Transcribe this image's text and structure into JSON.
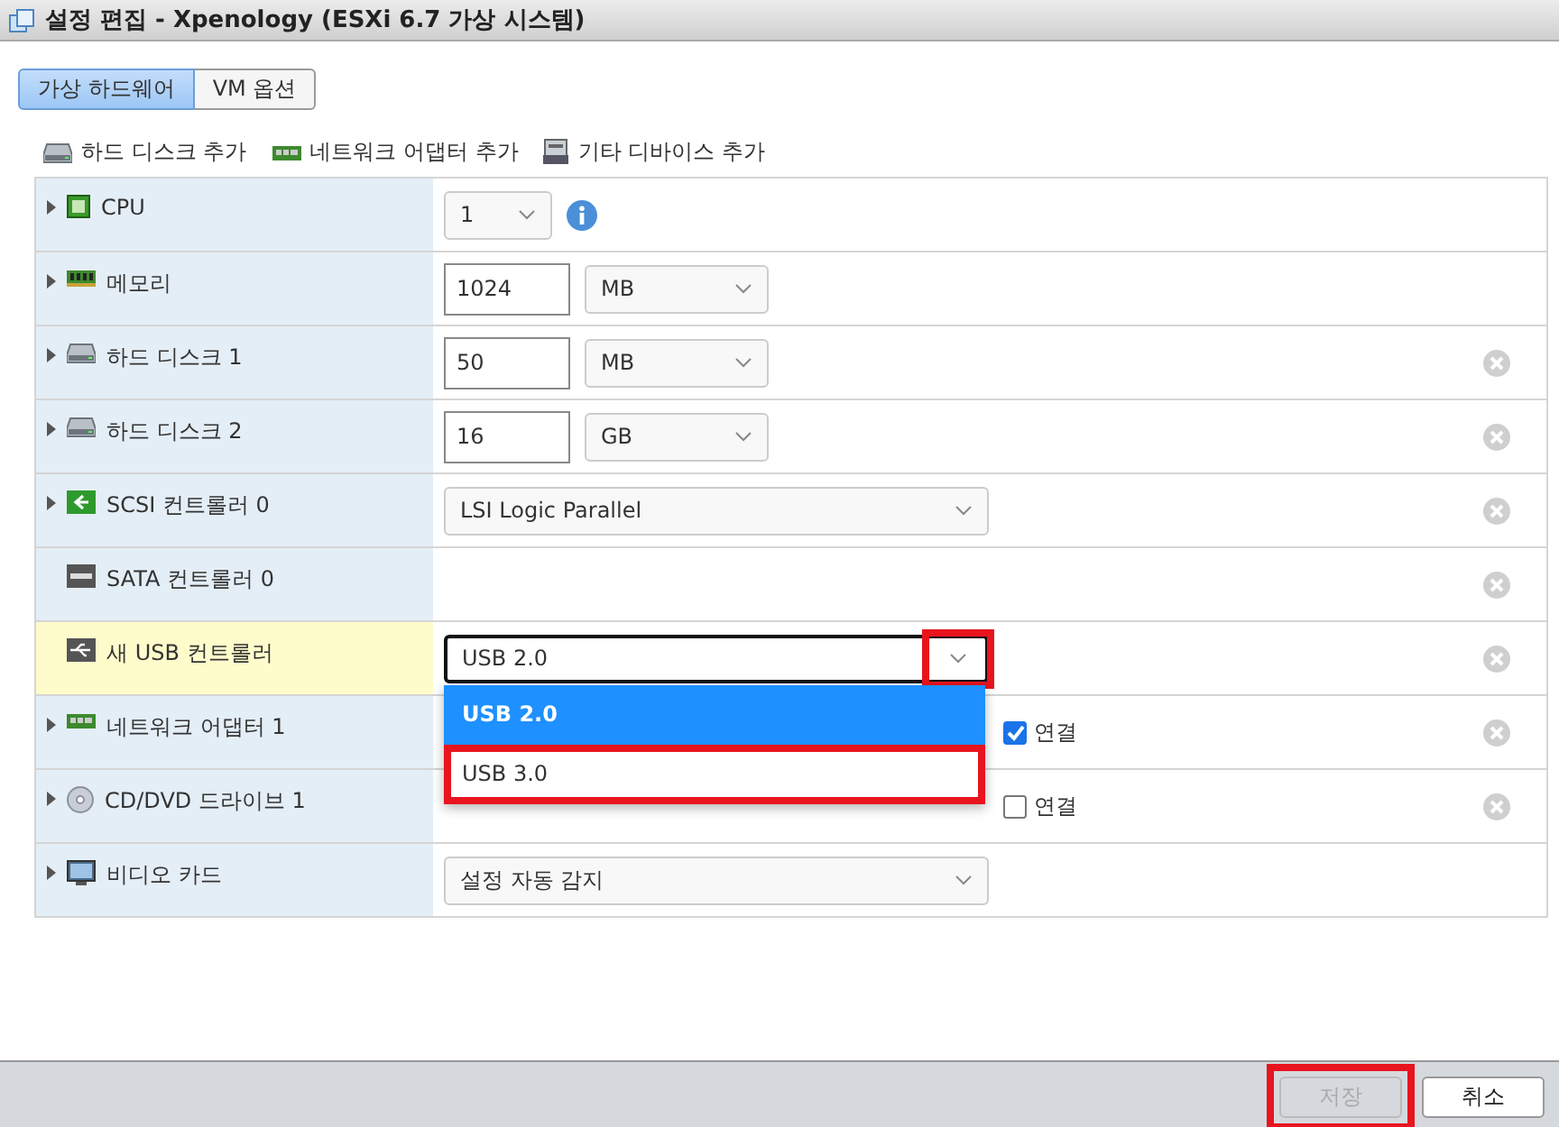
{
  "window": {
    "title": "설정 편집 - Xpenology (ESXi 6.7 가상 시스템)"
  },
  "tabs": [
    {
      "label": "가상 하드웨어",
      "selected": true
    },
    {
      "label": "VM 옵션",
      "selected": false
    }
  ],
  "toolbar": [
    {
      "kind": "disk",
      "label": "하드 디스크 추가"
    },
    {
      "kind": "network",
      "label": "네트워크 어댑터 추가"
    },
    {
      "kind": "other",
      "label": "기타 디바이스 추가"
    }
  ],
  "devices": [
    {
      "kind": "cpu",
      "label": "CPU",
      "expandable": true,
      "removable": false,
      "new": false,
      "control": {
        "kind": "small_select",
        "value": "1",
        "info": true
      }
    },
    {
      "kind": "memory",
      "label": "메모리",
      "expandable": true,
      "removable": false,
      "new": false,
      "control": {
        "kind": "size",
        "value": "1024",
        "unit": "MB"
      }
    },
    {
      "kind": "disk",
      "label": "하드 디스크 1",
      "expandable": true,
      "removable": true,
      "new": false,
      "control": {
        "kind": "size",
        "value": "50",
        "unit": "MB"
      }
    },
    {
      "kind": "disk",
      "label": "하드 디스크 2",
      "expandable": true,
      "removable": true,
      "new": false,
      "control": {
        "kind": "size",
        "value": "16",
        "unit": "GB"
      }
    },
    {
      "kind": "scsi",
      "label": "SCSI 컨트롤러 0",
      "expandable": true,
      "removable": true,
      "new": false,
      "control": {
        "kind": "select",
        "value": "LSI Logic Parallel"
      }
    },
    {
      "kind": "sata",
      "label": "SATA 컨트롤러 0",
      "expandable": false,
      "removable": true,
      "new": false,
      "control": {
        "kind": "none"
      }
    },
    {
      "kind": "usb",
      "label": "새 USB 컨트롤러",
      "expandable": false,
      "removable": true,
      "new": true,
      "control": {
        "kind": "select",
        "value": "USB 2.0",
        "focused": true,
        "caret_marked": true,
        "open": true
      }
    },
    {
      "kind": "network",
      "label": "네트워크 어댑터 1",
      "expandable": true,
      "removable": true,
      "new": false,
      "control": {
        "kind": "covered",
        "connect": {
          "label": "연결",
          "checked": true
        }
      }
    },
    {
      "kind": "cdrom",
      "label": "CD/DVD 드라이브 1",
      "expandable": true,
      "removable": true,
      "new": false,
      "control": {
        "kind": "covered",
        "connect": {
          "label": "연결",
          "checked": false
        }
      }
    },
    {
      "kind": "video",
      "label": "비디오 카드",
      "expandable": true,
      "removable": false,
      "new": false,
      "control": {
        "kind": "select",
        "value": "설정 자동 감지"
      }
    }
  ],
  "dropdown": {
    "options": [
      {
        "label": "USB 2.0",
        "selected": true,
        "marked": false
      },
      {
        "label": "USB 3.0",
        "selected": false,
        "marked": true
      }
    ]
  },
  "footer": {
    "buttons": [
      {
        "label": "저장",
        "disabled": true,
        "marked": true
      },
      {
        "label": "취소",
        "disabled": false,
        "marked": false
      }
    ]
  }
}
